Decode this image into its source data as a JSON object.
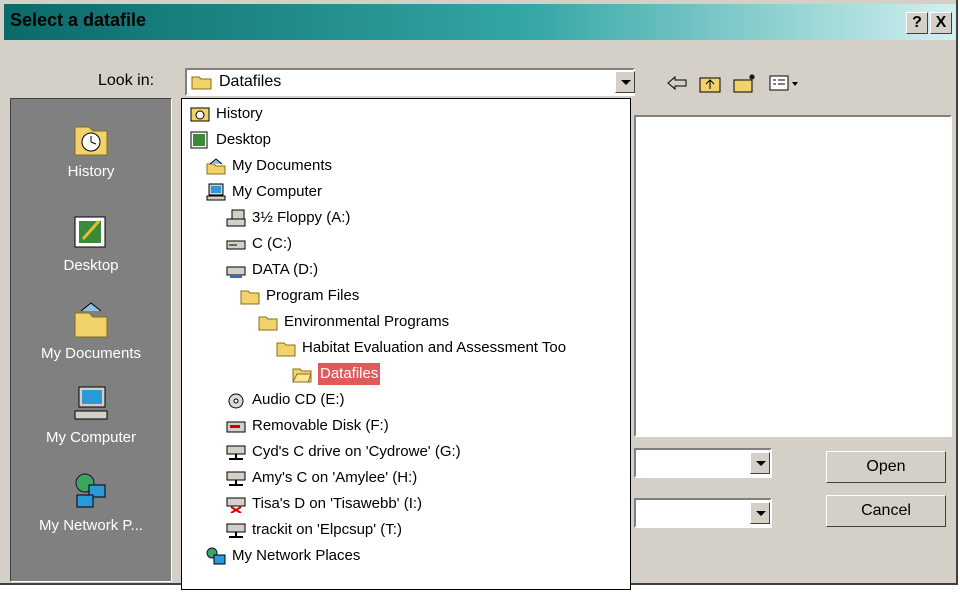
{
  "dialog": {
    "title": "Select a datafile",
    "help_label": "?",
    "close_label": "X"
  },
  "look_in": {
    "label": "Look in:",
    "value": "Datafiles"
  },
  "places": [
    {
      "label": "History",
      "icon": "history-icon"
    },
    {
      "label": "Desktop",
      "icon": "desktop-icon"
    },
    {
      "label": "My Documents",
      "icon": "my-documents-icon"
    },
    {
      "label": "My Computer",
      "icon": "my-computer-icon"
    },
    {
      "label": "My Network P...",
      "icon": "network-icon"
    }
  ],
  "dropdown": {
    "items": [
      {
        "label": "History",
        "icon": "history-icon"
      },
      {
        "label": "Desktop",
        "icon": "desktop-icon"
      },
      {
        "label": "My Documents",
        "icon": "my-documents-icon"
      },
      {
        "label": "My Computer",
        "icon": "my-computer-icon"
      },
      {
        "label": "3½ Floppy (A:)",
        "icon": "floppy-icon"
      },
      {
        "label": "C (C:)",
        "icon": "hard-drive-icon"
      },
      {
        "label": "DATA (D:)",
        "icon": "hard-drive-icon"
      },
      {
        "label": "Program Files",
        "icon": "folder-icon"
      },
      {
        "label": "Environmental Programs",
        "icon": "folder-icon"
      },
      {
        "label": "Habitat Evaluation and Assessment Too",
        "icon": "folder-icon"
      },
      {
        "label": "Datafiles",
        "icon": "open-folder-icon",
        "selected": true
      },
      {
        "label": "Audio CD (E:)",
        "icon": "cd-icon"
      },
      {
        "label": "Removable Disk (F:)",
        "icon": "removable-disk-icon"
      },
      {
        "label": "Cyd's C drive on 'Cydrowe' (G:)",
        "icon": "network-drive-icon"
      },
      {
        "label": "Amy's C on 'Amylee' (H:)",
        "icon": "network-drive-icon"
      },
      {
        "label": "Tisa's D on 'Tisawebb' (I:)",
        "icon": "disconnected-drive-icon"
      },
      {
        "label": "trackit on 'Elpcsup' (T:)",
        "icon": "network-drive-icon"
      },
      {
        "label": "My Network Places",
        "icon": "network-icon"
      }
    ]
  },
  "buttons": {
    "open": "Open",
    "cancel": "Cancel"
  },
  "toolbar": [
    "back-arrow-icon",
    "up-folder-icon",
    "new-folder-icon",
    "view-menu-icon"
  ]
}
